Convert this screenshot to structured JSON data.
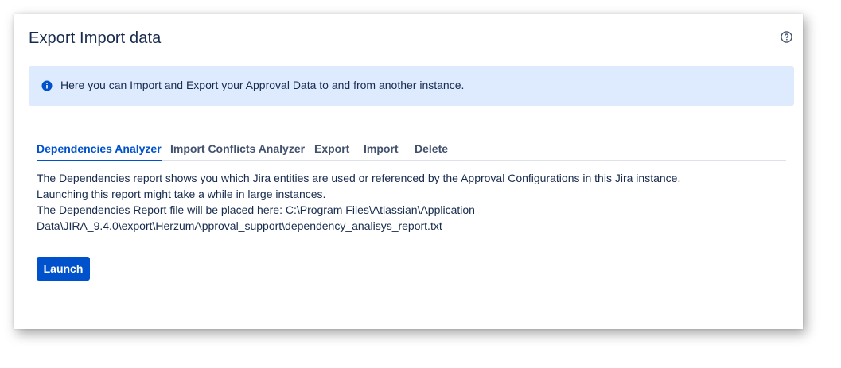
{
  "page": {
    "title": "Export Import data"
  },
  "info_banner": {
    "text": "Here you can Import and Export your Approval Data to and from another instance.",
    "icon": "info-icon",
    "background": "#deebff",
    "icon_color": "#0052cc"
  },
  "tabs": [
    {
      "label": "Dependencies Analyzer",
      "active": true
    },
    {
      "label": "Import Conflicts Analyzer",
      "active": false
    },
    {
      "label": "Export",
      "active": false
    },
    {
      "label": "Import",
      "active": false
    },
    {
      "label": "Delete",
      "active": false
    }
  ],
  "description": {
    "lines": [
      "The Dependencies report shows you which Jira entities are used or referenced by the Approval Configurations in this Jira instance.",
      "Launching this report might take a while in large instances.",
      "The Dependencies Report file will be placed here: C:\\Program Files\\Atlassian\\Application",
      "Data\\JIRA_9.4.0\\export\\HerzumApproval_support\\dependency_analisys_report.txt"
    ]
  },
  "actions": {
    "launch_label": "Launch"
  },
  "colors": {
    "accent": "#0052cc",
    "text": "#172b4d",
    "tab_inactive": "#42526e"
  }
}
